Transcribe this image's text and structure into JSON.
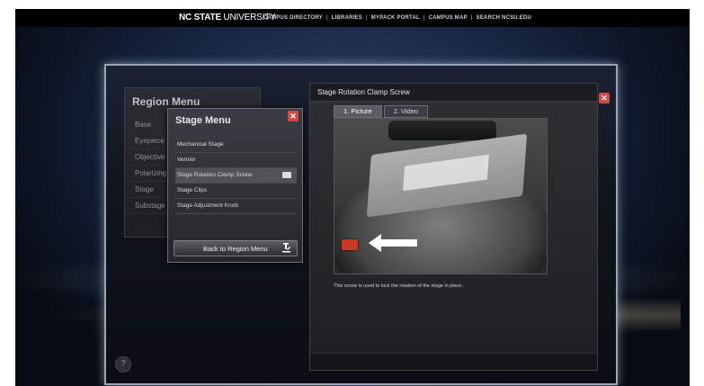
{
  "header": {
    "brand_bold": "NC STATE",
    "brand_light": "UNIVERSITY",
    "links": [
      "CAMPUS DIRECTORY",
      "LIBRARIES",
      "MYPACK PORTAL",
      "CAMPUS MAP",
      "SEARCH NCSU.EDU"
    ]
  },
  "region_menu": {
    "title": "Region Menu",
    "items": [
      "Base",
      "Eyepiece",
      "Objective",
      "Polarizing",
      "Stage",
      "Substage"
    ]
  },
  "stage_menu": {
    "title": "Stage Menu",
    "items": [
      {
        "label": "Mechanical Stage",
        "active": false
      },
      {
        "label": "Vernier",
        "active": false
      },
      {
        "label": "Stage Rotation Clamp Screw",
        "active": true
      },
      {
        "label": "Stage Clips",
        "active": false
      },
      {
        "label": "Stage Adjustment Knob",
        "active": false
      }
    ],
    "back_label": "Back to Region Menu"
  },
  "panel": {
    "title": "Stage Rotation Clamp Screw",
    "tabs": [
      "1. Picture",
      "2. Video"
    ],
    "active_tab": 0,
    "caption": "This screw is used to lock the rotation of the stage in place."
  },
  "icons": {
    "close": "close-icon",
    "back": "microscope-icon",
    "help": "help-icon",
    "arrow": "arrow-left-icon"
  },
  "colors": {
    "accent_close": "#d24a43",
    "highlight_red": "#c93a26"
  }
}
